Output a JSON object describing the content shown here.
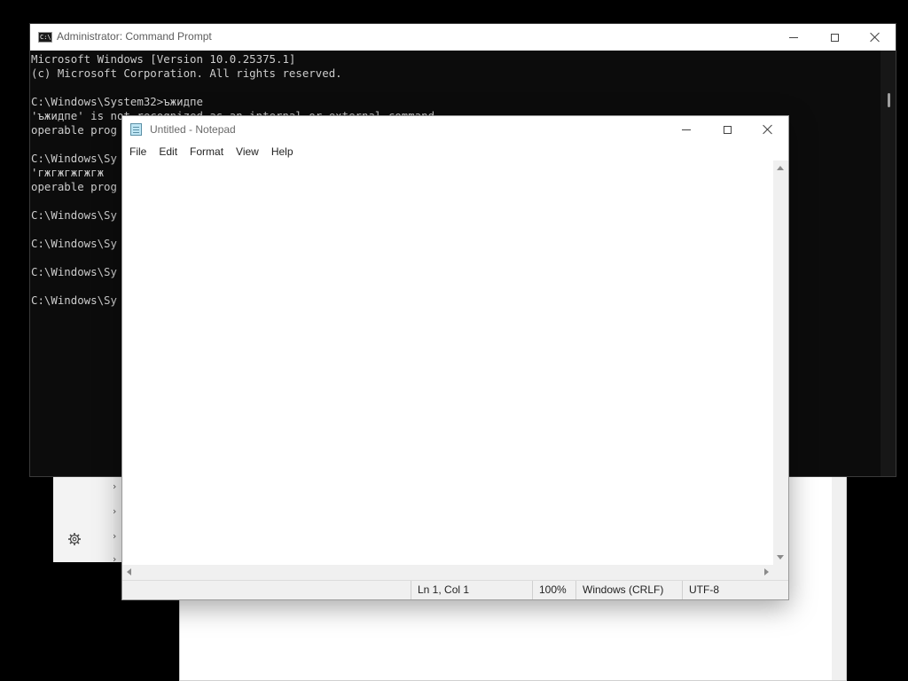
{
  "cmd": {
    "title": "Administrator: Command Prompt",
    "icon_text": "C:\\",
    "icon": "cmd-icon",
    "console_lines": [
      "Microsoft Windows [Version 10.0.25375.1]",
      "(c) Microsoft Corporation. All rights reserved.",
      "",
      "C:\\Windows\\System32>ъжидпе",
      "'ъжидпе' is not recognized as an internal or external command,",
      "operable prog",
      "",
      "C:\\Windows\\Sy",
      "'гжгжгжгжгж",
      "operable prog",
      "",
      "C:\\Windows\\Sy",
      "",
      "C:\\Windows\\Sy",
      "",
      "C:\\Windows\\Sy",
      "",
      "C:\\Windows\\Sy"
    ],
    "colors": {
      "background": "#0c0c0c",
      "text": "#cccccc"
    }
  },
  "notepad": {
    "title": "Untitled - Notepad",
    "icon": "notepad-icon",
    "menu": [
      "File",
      "Edit",
      "Format",
      "View",
      "Help"
    ],
    "content": "",
    "status": {
      "position": "Ln 1, Col 1",
      "zoom": "100%",
      "line_ending": "Windows (CRLF)",
      "encoding": "UTF-8"
    }
  },
  "background_windows": {
    "left_sidebar_icon": "gear-icon",
    "left_sidebar_chevrons": 4,
    "right_window_close_icon": "close-icon"
  }
}
